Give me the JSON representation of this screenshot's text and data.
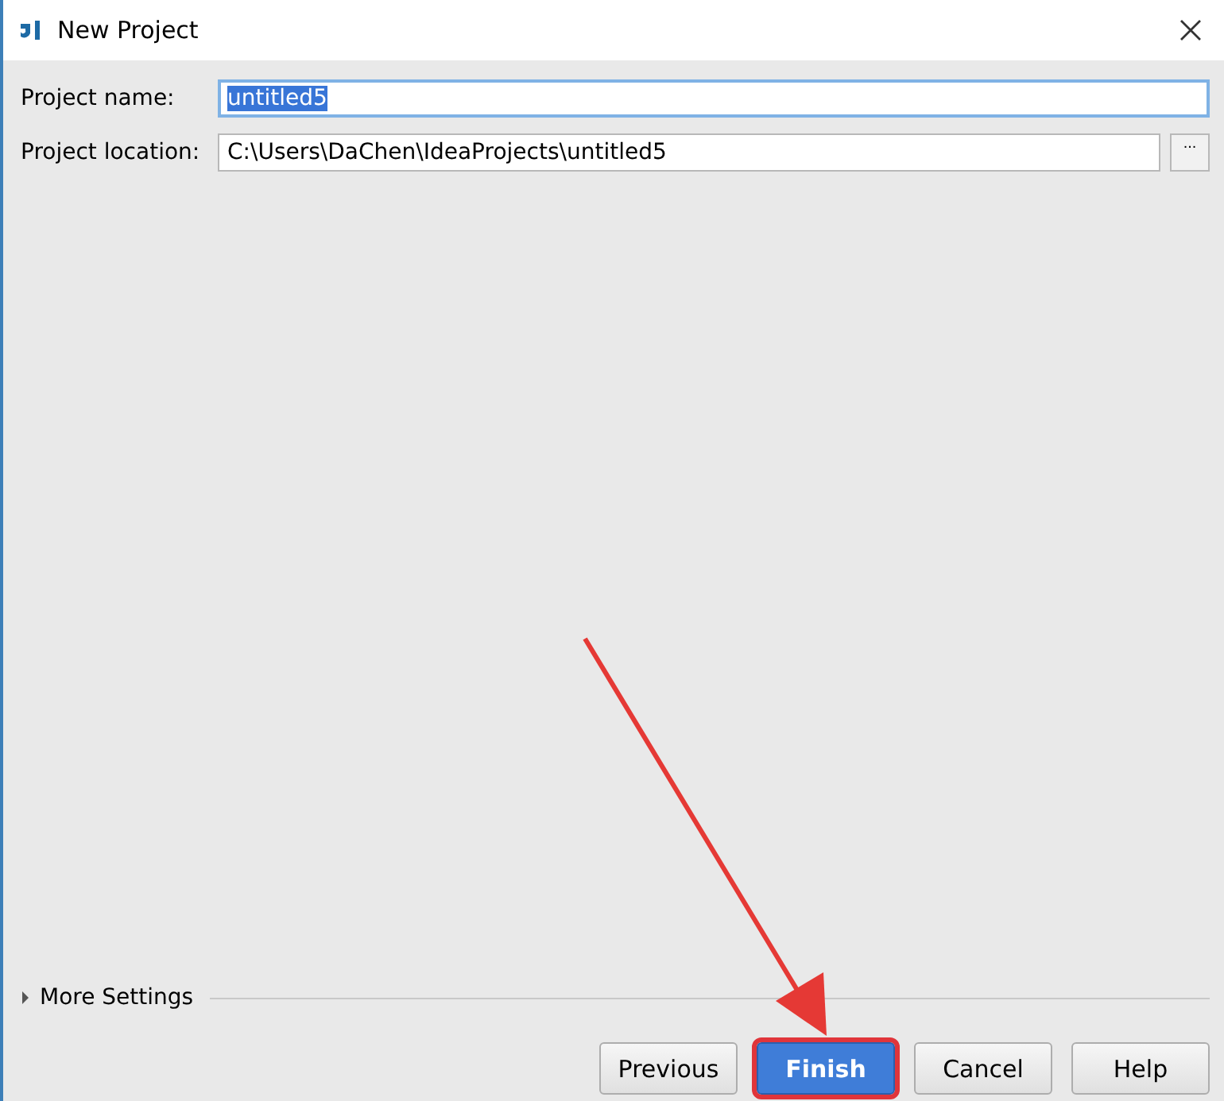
{
  "window": {
    "title": "New Project"
  },
  "fields": [
    {
      "label": "Project name:",
      "value": "untitled5",
      "focused": true,
      "browse": false
    },
    {
      "label": "Project location:",
      "value": "C:\\Users\\DaChen\\IdeaProjects\\untitled5",
      "focused": false,
      "browse": true,
      "browse_label": "..."
    }
  ],
  "more_settings": {
    "label": "More Settings",
    "expanded": false
  },
  "buttons": [
    {
      "label": "Previous",
      "default": false,
      "highlighted": false
    },
    {
      "label": "Finish",
      "default": true,
      "highlighted": true
    },
    {
      "label": "Cancel",
      "default": false,
      "highlighted": false
    },
    {
      "label": "Help",
      "default": false,
      "highlighted": false
    }
  ]
}
